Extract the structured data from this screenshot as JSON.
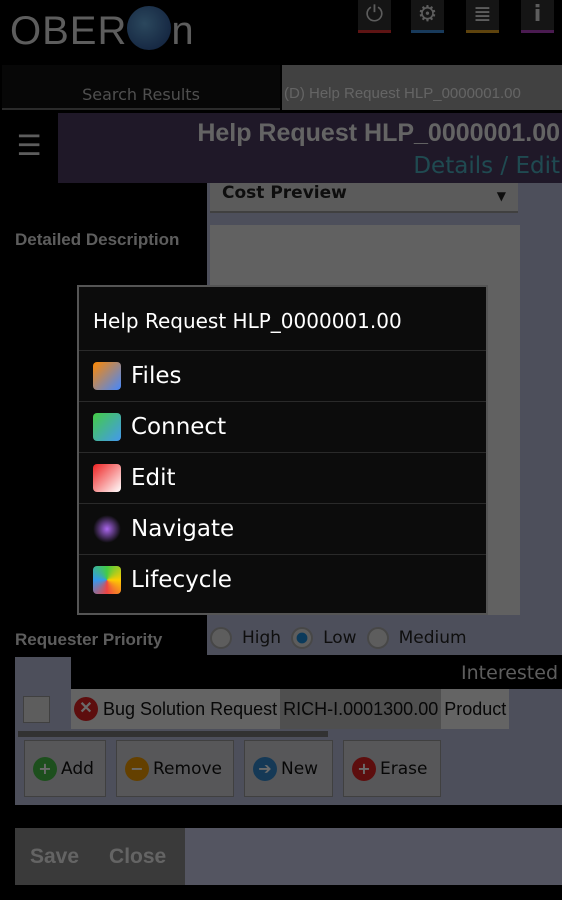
{
  "header": {
    "logo": "OBERON",
    "icons": [
      {
        "name": "power-icon",
        "color": "#e03030"
      },
      {
        "name": "gear-icon",
        "color": "#3a8ad8"
      },
      {
        "name": "list-icon",
        "color": "#e0a020"
      },
      {
        "name": "info-icon",
        "color": "#b040c0"
      }
    ]
  },
  "tabs": [
    {
      "label": "Search Results"
    },
    {
      "label": "(D) Help Request HLP_0000001.00"
    }
  ],
  "titlebar": {
    "title": "Help Request HLP_0000001.00",
    "subtitle": "Details / Edit"
  },
  "form": {
    "cost_preview": "Cost Preview",
    "detailed_description_label": "Detailed Description",
    "priority_label": "Requester Priority",
    "priority_options": [
      "High",
      "Low",
      "Medium"
    ],
    "priority_selected": "Low"
  },
  "table": {
    "header": "Interested",
    "row": {
      "name": "Bug Solution Request",
      "id": "RICH-I.0001300.00",
      "type": "Product"
    }
  },
  "buttons": {
    "add": "Add",
    "remove": "Remove",
    "new": "New",
    "erase": "Erase"
  },
  "footer": {
    "save": "Save",
    "close": "Close"
  },
  "dialog": {
    "title": "Help Request HLP_0000001.00",
    "items": [
      {
        "label": "Files"
      },
      {
        "label": "Connect"
      },
      {
        "label": "Edit"
      },
      {
        "label": "Navigate"
      },
      {
        "label": "Lifecycle"
      }
    ]
  }
}
